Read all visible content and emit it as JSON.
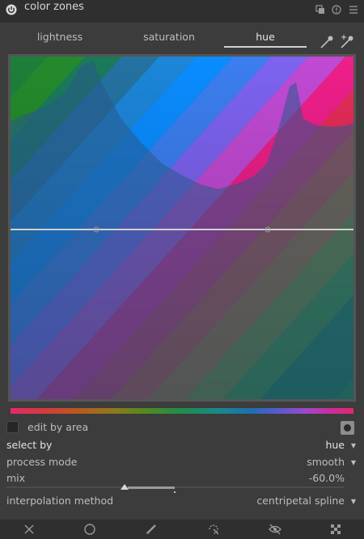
{
  "header": {
    "title": "color zones",
    "icons": [
      "power-icon",
      "multi-instance-icon",
      "reset-icon",
      "presets-icon"
    ]
  },
  "tabs": [
    {
      "label": "lightness",
      "active": false
    },
    {
      "label": "saturation",
      "active": false
    },
    {
      "label": "hue",
      "active": true
    }
  ],
  "pickers": [
    "color-picker-icon",
    "color-picker-set-values-icon"
  ],
  "edit_by_area": {
    "label": "edit by area",
    "checked": false
  },
  "select_by": {
    "label": "select by",
    "value": "hue"
  },
  "process_mode": {
    "label": "process mode",
    "value": "smooth"
  },
  "mix": {
    "label": "mix",
    "value": "-60.0%",
    "level": -0.6
  },
  "interpolation": {
    "label": "interpolation method",
    "value": "centripetal spline"
  },
  "footer_icons": [
    "close-icon",
    "circle-icon",
    "pencil-icon",
    "dropper-icon",
    "eye-icon",
    "checkerboard-icon"
  ],
  "colors": {
    "panel": "#3c3c3c",
    "header": "#2f2f2f",
    "curve": "#d0d0d0"
  }
}
